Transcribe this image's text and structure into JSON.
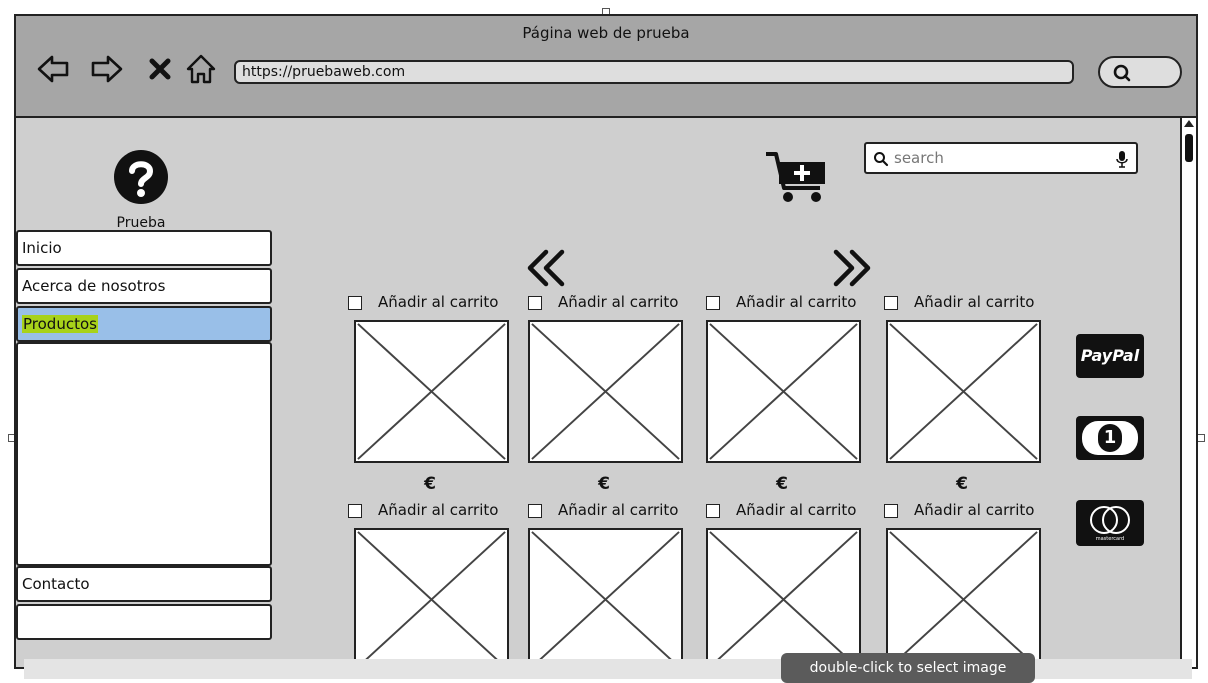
{
  "window": {
    "title": "Página web de prueba",
    "url": "https://pruebaweb.com",
    "nav_icons": [
      "back-arrow-icon",
      "forward-arrow-icon",
      "stop-icon",
      "home-icon"
    ]
  },
  "logo": {
    "icon": "question-icon",
    "label": "Prueba"
  },
  "sidebar": {
    "items": [
      {
        "label": "Inicio"
      },
      {
        "label": "Acerca de nosotros"
      },
      {
        "label": "Productos",
        "selected": true
      },
      {
        "label": "Contacto"
      },
      {
        "label": ""
      }
    ]
  },
  "header": {
    "cart_icon": "add-to-cart-icon",
    "search": {
      "placeholder": "search",
      "value": ""
    }
  },
  "pager": {
    "prev": "«",
    "next": "»"
  },
  "products": {
    "rows": [
      [
        {
          "label": "Añadir al carrito",
          "price": "€"
        },
        {
          "label": "Añadir al carrito",
          "price": "€"
        },
        {
          "label": "Añadir al carrito",
          "price": "€"
        },
        {
          "label": "Añadir al carrito",
          "price": ""
        }
      ],
      [
        {
          "label": "Añadir al carrito",
          "price": "€"
        },
        {
          "label": "Añadir al carrito",
          "price": "€"
        },
        {
          "label": "Añadir al carrito",
          "price": "€"
        },
        {
          "label": "Añadir al carrito",
          "price": "€"
        }
      ]
    ]
  },
  "payments": [
    {
      "name": "paypal-icon",
      "text": "PayPal"
    },
    {
      "name": "cash-icon",
      "text": "1"
    },
    {
      "name": "mastercard-icon",
      "text": "mastercard"
    }
  ],
  "editor": {
    "tooltip": "double-click to select image"
  },
  "colors": {
    "titlebar": "#a6a6a6",
    "content": "#cfcfcf",
    "selected": "#99bfe8",
    "highlight": "#a8d21a"
  }
}
